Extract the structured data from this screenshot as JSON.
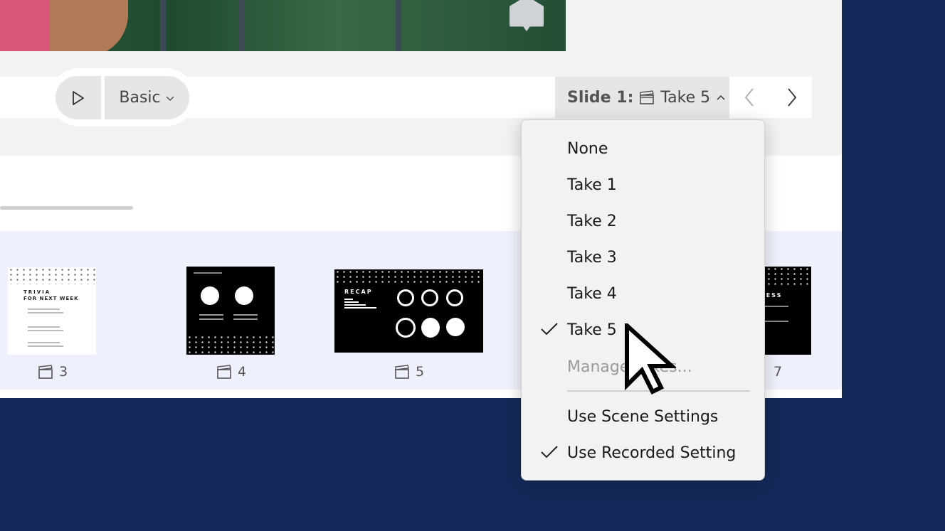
{
  "toolbar": {
    "play_icon": "play-icon",
    "style_label": "Basic",
    "slide_prefix": "Slide 1:",
    "take_label": "Take 5",
    "prev_icon": "chevron-left-icon",
    "next_icon": "chevron-right-icon"
  },
  "filmstrip": {
    "slides": [
      {
        "number": "3",
        "title_line1": "TRIVIA",
        "title_line2": "FOR NEXT WEEK"
      },
      {
        "number": "4"
      },
      {
        "number": "5",
        "title_line1": "RECAP"
      },
      {
        "number": "7",
        "title_line1": "NESS"
      }
    ]
  },
  "menu": {
    "items": [
      {
        "label": "None",
        "checked": false
      },
      {
        "label": "Take 1",
        "checked": false
      },
      {
        "label": "Take 2",
        "checked": false
      },
      {
        "label": "Take 3",
        "checked": false
      },
      {
        "label": "Take 4",
        "checked": false
      },
      {
        "label": "Take 5",
        "checked": true
      },
      {
        "label": "Manage Takes...",
        "disabled": true
      }
    ],
    "settings": [
      {
        "label": "Use Scene Settings",
        "checked": false
      },
      {
        "label": "Use Recorded Setting",
        "checked": true
      }
    ]
  },
  "colors": {
    "background": "#132a5a",
    "filmstrip": "#eef1fb",
    "menu": "#f2f2f2"
  }
}
